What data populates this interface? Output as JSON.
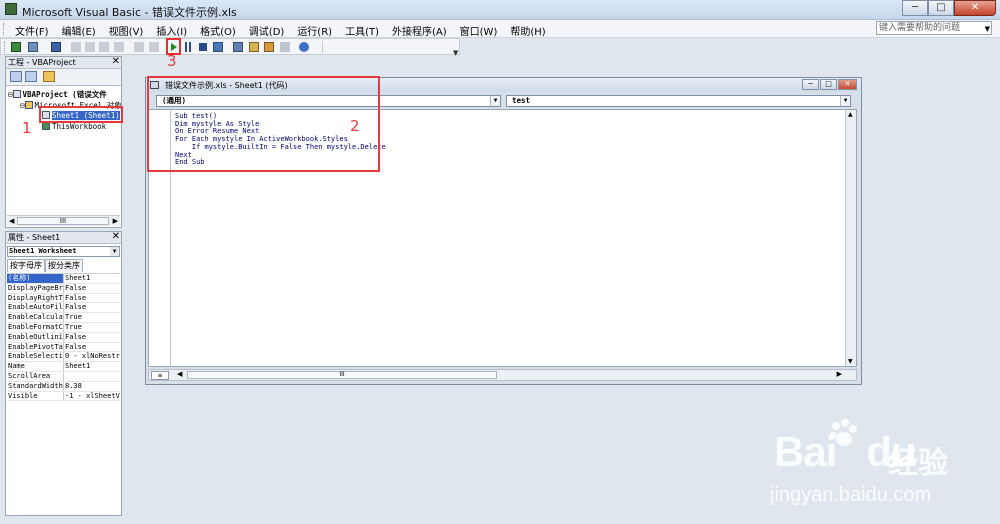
{
  "window": {
    "title": "Microsoft Visual Basic - 错误文件示例.xls",
    "min": "─",
    "max": "□",
    "close": "✕"
  },
  "menu": {
    "items": [
      "文件(F)",
      "编辑(E)",
      "视图(V)",
      "插入(I)",
      "格式(O)",
      "调试(D)",
      "运行(R)",
      "工具(T)",
      "外接程序(A)",
      "窗口(W)",
      "帮助(H)"
    ],
    "help_placeholder": "键入需要帮助的问题"
  },
  "project": {
    "title": "工程 - VBAProject",
    "tree": [
      "VBAProject (错误文件",
      "Microsoft Excel 对象",
      "Sheet1 (Sheet1)",
      "ThisWorkbook"
    ],
    "scroll_label": "III"
  },
  "properties": {
    "title": "属性 - Sheet1",
    "object": "Sheet1 Worksheet",
    "tabs": [
      "按字母序",
      "按分类序"
    ],
    "rows": [
      {
        "k": "(名称)",
        "v": "Sheet1"
      },
      {
        "k": "DisplayPageBre",
        "v": "False"
      },
      {
        "k": "DisplayRightTo",
        "v": "False"
      },
      {
        "k": "EnableAutoFilt",
        "v": "False"
      },
      {
        "k": "EnableCalculat",
        "v": "True"
      },
      {
        "k": "EnableFormatCo",
        "v": "True"
      },
      {
        "k": "EnableOutlinin",
        "v": "False"
      },
      {
        "k": "EnablePivotTab",
        "v": "False"
      },
      {
        "k": "EnableSelectio",
        "v": "0 - xlNoRestr"
      },
      {
        "k": "Name",
        "v": "Sheet1"
      },
      {
        "k": "ScrollArea",
        "v": ""
      },
      {
        "k": "StandardWidth",
        "v": "8.38"
      },
      {
        "k": "Visible",
        "v": "-1 - xlSheetV"
      }
    ]
  },
  "code_window": {
    "title": "错误文件示例.xls - Sheet1 (代码)",
    "object_combo": "(通用)",
    "proc_combo": "test",
    "code": "Sub test()\nDim mystyle As Style\nOn Error Resume Next\nFor Each mystyle In ActiveWorkbook.Styles\n    If mystyle.BuiltIn = False Then mystyle.Delete\nNext\nEnd Sub"
  },
  "annotations": [
    "1",
    "2",
    "3"
  ],
  "watermark": {
    "logo": "Bai",
    "logo2": "du",
    "cn": "经验",
    "url": "jingyan.baidu.com"
  },
  "colors": {
    "annotation": "#e23b3b",
    "selection": "#3465c9",
    "run_icon": "#1e8a1e"
  }
}
